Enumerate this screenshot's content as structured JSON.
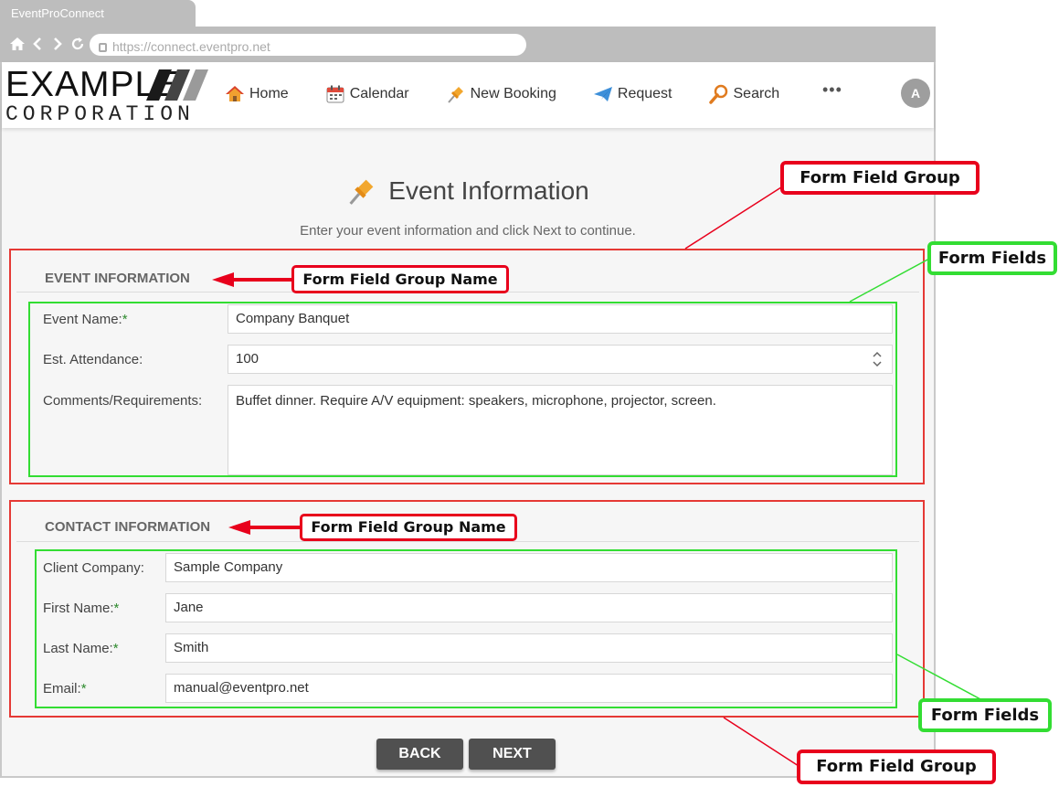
{
  "browser": {
    "tab_title": "EventProConnect",
    "url": "https://connect.eventpro.net"
  },
  "logo": {
    "line1": "EXAMPLE",
    "line2": "CORPORATION"
  },
  "nav": {
    "items": [
      {
        "label": "Home",
        "icon": "house-icon"
      },
      {
        "label": "Calendar",
        "icon": "calendar-icon"
      },
      {
        "label": "New Booking",
        "icon": "pushpin-icon"
      },
      {
        "label": "Request",
        "icon": "paper-plane-icon"
      },
      {
        "label": "Search",
        "icon": "magnifier-icon"
      }
    ],
    "more": "•••",
    "avatar": "A"
  },
  "page": {
    "title": "Event Information",
    "subtitle": "Enter your event information and click Next to continue."
  },
  "event_group": {
    "title": "EVENT INFORMATION",
    "fields": {
      "event_name": {
        "label": "Event Name:",
        "required": "*",
        "value": "Company Banquet"
      },
      "attendance": {
        "label": "Est. Attendance:",
        "value": "100"
      },
      "comments": {
        "label": "Comments/Requirements:",
        "value": "Buffet dinner. Require A/V equipment: speakers, microphone, projector, screen."
      }
    }
  },
  "contact_group": {
    "title": "CONTACT INFORMATION",
    "fields": {
      "company": {
        "label": "Client Company:",
        "value": "Sample Company"
      },
      "first_name": {
        "label": "First Name:",
        "required": "*",
        "value": "Jane"
      },
      "last_name": {
        "label": "Last Name:",
        "required": "*",
        "value": "Smith"
      },
      "email": {
        "label": "Email:",
        "required": "*",
        "value": "manual@eventpro.net"
      }
    }
  },
  "buttons": {
    "back": "BACK",
    "next": "NEXT"
  },
  "annotations": {
    "form_field_group": "Form Field Group",
    "form_fields": "Form Fields",
    "form_field_group_name": "Form Field Group Name",
    "colors": {
      "group": "#e8001c",
      "fields": "#33dd33"
    }
  }
}
